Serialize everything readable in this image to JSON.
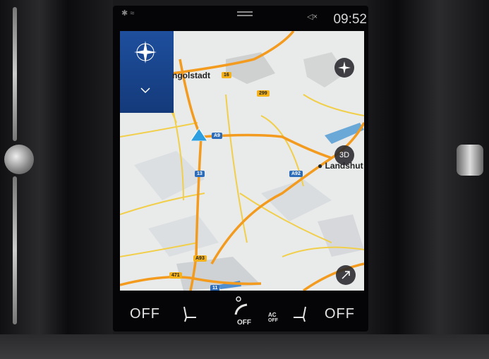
{
  "status": {
    "time": "09:52"
  },
  "map": {
    "cities": [
      {
        "name": "ngolstadt"
      },
      {
        "name": "Landshut"
      }
    ],
    "road_badges": [
      "16",
      "299",
      "A9",
      "A92",
      "13",
      "A93",
      "471",
      "11"
    ],
    "view_button": "3D"
  },
  "climate": {
    "left_temp": "OFF",
    "right_temp": "OFF",
    "fan_label": "OFF",
    "ac_label_top": "AC",
    "ac_label_bottom": "OFF"
  }
}
